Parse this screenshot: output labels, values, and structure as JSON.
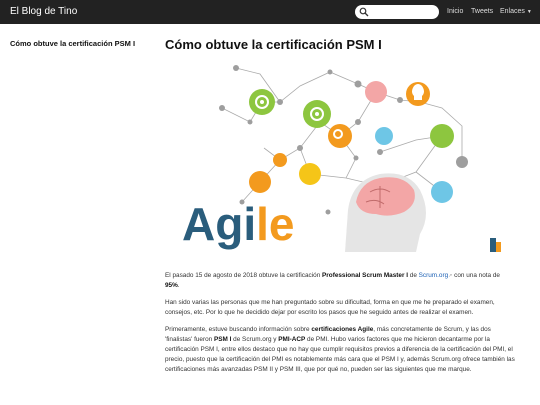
{
  "navbar": {
    "brand": "El Blog de Tino",
    "search_placeholder": "",
    "links": [
      "Inicio",
      "Tweets",
      "Enlaces"
    ]
  },
  "sidebar": {
    "item_label": "Cómo obtuve la certificación PSM I"
  },
  "post": {
    "title": "Cómo obtuve la certificación PSM I",
    "image_text": "Agile",
    "p1": {
      "t1": "El pasado 15 de agosto de 2018 obtuve la certificación ",
      "b1": "Professional Scrum Master I",
      "t2": " de ",
      "link": "Scrum.org",
      "t3": " con una nota de ",
      "b2": "95%",
      "t4": "."
    },
    "p2": "Han sido varias las personas que me han preguntado sobre su dificultad, forma en que me he preparado el examen, consejos, etc. Por lo que he decidido dejar por escrito los pasos que he seguido antes de realizar el examen.",
    "p3": {
      "t1": "Primeramente, estuve buscando información sobre ",
      "b1": "certificaciones Agile",
      "t2": ", más concretamente de Scrum, y las dos 'finalistas' fueron ",
      "b2": "PSM I",
      "t3": " de Scrum.org y ",
      "b3": "PMI-ACP",
      "t4": " de PMI. Hubo varios factores que me hicieron decantarme por la certificación PSM I, entre ellos destaco que no hay que cumplir requisitos previos a diferencia de la certificación del PMI, el precio, puesto que la certificación del PMI es notablemente más cara que el PSM I y, además Scrum.org ofrece también las certificaciones más avanzadas PSM II y PSM III, que por qué no, pueden ser las siguientes que me marque."
    }
  },
  "colors": {
    "navbar_bg": "#222222",
    "link": "#1a5fb4",
    "agile_blue": "#2a5d7c",
    "agile_orange": "#f39a1e"
  }
}
